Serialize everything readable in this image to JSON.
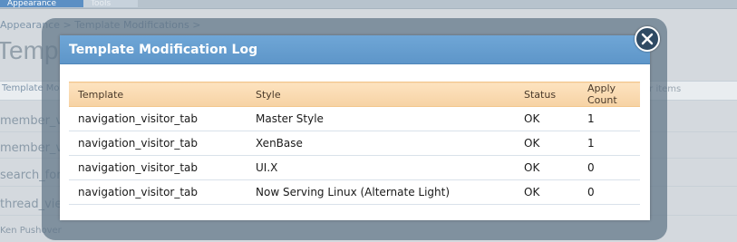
{
  "background": {
    "tabs": [
      "Appearance",
      "Tools"
    ],
    "breadcrumb": "Appearance >   Template Modifications >",
    "page_title": "Template",
    "filter_left": "Template Mo",
    "filter_right": "er items",
    "list_items": [
      "member_vie",
      "member_vie",
      "search_form",
      "thread_view",
      "Ken Pushover"
    ]
  },
  "dialog": {
    "title": "Template Modification Log",
    "close_icon": "close-icon",
    "columns": [
      "Template",
      "Style",
      "Status",
      "Apply Count"
    ],
    "rows": [
      {
        "template": "navigation_visitor_tab",
        "style": "Master Style",
        "status": "OK",
        "apply_count": "1"
      },
      {
        "template": "navigation_visitor_tab",
        "style": "XenBase",
        "status": "OK",
        "apply_count": "1"
      },
      {
        "template": "navigation_visitor_tab",
        "style": "UI.X",
        "status": "OK",
        "apply_count": "0"
      },
      {
        "template": "navigation_visitor_tab",
        "style": "Now Serving Linux (Alternate Light)",
        "status": "OK",
        "apply_count": "0"
      }
    ]
  },
  "colors": {
    "header_blue": "#5e96c9",
    "table_header": "#f6d2a4",
    "overlay": "#607587",
    "close_button": "#2f4a63"
  }
}
